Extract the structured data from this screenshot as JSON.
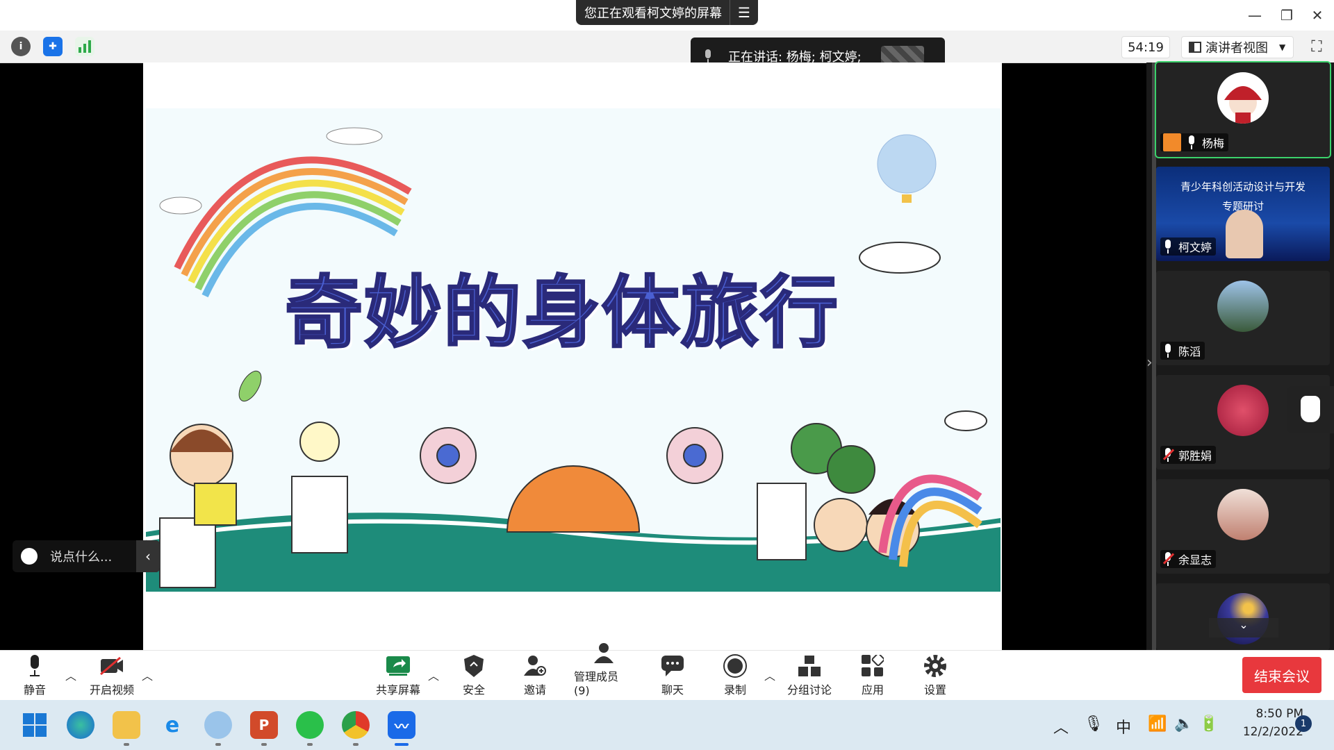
{
  "titlebar": {
    "share_notice": "您正在观看柯文婷的屏幕",
    "menu_icon": "menu-icon"
  },
  "window_controls": {
    "minimize": "—",
    "restore": "❐",
    "close": "✕"
  },
  "infobar": {
    "timer": "54:19",
    "view_mode": "演讲者视图",
    "speaking": "正在讲话: 杨梅; 柯文婷;"
  },
  "slide": {
    "title": "奇妙的身体旅行"
  },
  "gallery": {
    "participants": [
      {
        "name": "杨梅",
        "muted": false,
        "host": true
      },
      {
        "name": "柯文婷",
        "muted": false,
        "video": "青少年科创活动设计与开发专题研讨"
      },
      {
        "name": "陈滔",
        "muted": false
      },
      {
        "name": "郭胜娟",
        "muted": true
      },
      {
        "name": "余显志",
        "muted": true
      },
      {
        "name": "",
        "muted": false
      }
    ],
    "video_line1": "青少年科创活动设计与开发",
    "video_line2": "专题研讨"
  },
  "chat": {
    "placeholder": "说点什么..."
  },
  "toolbar": {
    "mute": "静音",
    "video": "开启视频",
    "share": "共享屏幕",
    "security": "安全",
    "invite": "邀请",
    "members": "管理成员(9)",
    "chat": "聊天",
    "record": "录制",
    "breakout": "分组讨论",
    "apps": "应用",
    "settings": "设置",
    "end": "结束会议"
  },
  "taskbar": {
    "time": "8:50 PM",
    "date": "12/2/2022",
    "ime": "中",
    "notifications": "1"
  },
  "colors": {
    "end_button": "#e8383d",
    "active_tile": "#3bd26b",
    "title_fill": "#4a5fd2"
  }
}
